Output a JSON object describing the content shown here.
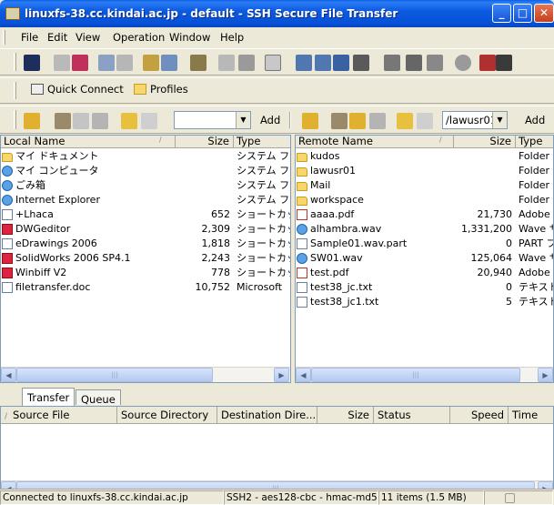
{
  "window": {
    "title": "linuxfs-38.cc.kindai.ac.jp - default - SSH Secure File Transfer"
  },
  "menu": [
    "File",
    "Edit",
    "View",
    "Operation",
    "Window",
    "Help"
  ],
  "toolbar2": {
    "quick_connect": "Quick Connect",
    "profiles": "Profiles"
  },
  "local": {
    "add_label": "Add",
    "path": "",
    "columns": {
      "name": "Local Name",
      "size": "Size",
      "type": "Type"
    },
    "rows": [
      {
        "name": "マイ ドキュメント",
        "size": "",
        "type": "システム フ",
        "icon": "my-documents-icon"
      },
      {
        "name": "マイ コンピュータ",
        "size": "",
        "type": "システム フ",
        "icon": "my-computer-icon"
      },
      {
        "name": "ごみ箱",
        "size": "",
        "type": "システム フ",
        "icon": "recycle-bin-icon"
      },
      {
        "name": "Internet Explorer",
        "size": "",
        "type": "システム フ",
        "icon": "internet-explorer-icon"
      },
      {
        "name": "+Lhaca",
        "size": "652",
        "type": "ショートカッ",
        "icon": "lhaca-icon"
      },
      {
        "name": "DWGeditor",
        "size": "2,309",
        "type": "ショートカッ",
        "icon": "dwgeditor-icon"
      },
      {
        "name": "eDrawings 2006",
        "size": "1,818",
        "type": "ショートカッ",
        "icon": "edrawings-icon"
      },
      {
        "name": "SolidWorks 2006 SP4.1",
        "size": "2,243",
        "type": "ショートカッ",
        "icon": "solidworks-icon"
      },
      {
        "name": "Winbiff V2",
        "size": "778",
        "type": "ショートカッ",
        "icon": "winbiff-icon"
      },
      {
        "name": "filetransfer.doc",
        "size": "10,752",
        "type": "Microsoft",
        "icon": "word-document-icon"
      }
    ]
  },
  "remote": {
    "add_label": "Add",
    "path": "/lawusr01",
    "columns": {
      "name": "Remote Name",
      "size": "Size",
      "type": "Type"
    },
    "rows": [
      {
        "name": "kudos",
        "size": "",
        "type": "Folder",
        "icon": "folder-icon"
      },
      {
        "name": "lawusr01",
        "size": "",
        "type": "Folder",
        "icon": "folder-icon"
      },
      {
        "name": "Mail",
        "size": "",
        "type": "Folder",
        "icon": "folder-icon"
      },
      {
        "name": "workspace",
        "size": "",
        "type": "Folder",
        "icon": "folder-icon"
      },
      {
        "name": "aaaa.pdf",
        "size": "21,730",
        "type": "Adobe A",
        "icon": "pdf-file-icon"
      },
      {
        "name": "alhambra.wav",
        "size": "1,331,200",
        "type": "Wave サ",
        "icon": "wave-file-icon"
      },
      {
        "name": "Sample01.wav.part",
        "size": "0",
        "type": "PART フ",
        "icon": "part-file-icon"
      },
      {
        "name": "SW01.wav",
        "size": "125,064",
        "type": "Wave サ",
        "icon": "wave-file-icon"
      },
      {
        "name": "test.pdf",
        "size": "20,940",
        "type": "Adobe A",
        "icon": "pdf-file-icon"
      },
      {
        "name": "test38_jc.txt",
        "size": "0",
        "type": "テキスト文",
        "icon": "text-file-icon"
      },
      {
        "name": "test38_jc1.txt",
        "size": "5",
        "type": "テキスト文",
        "icon": "text-file-icon"
      }
    ]
  },
  "tabs": [
    "Transfer",
    "Queue"
  ],
  "transfer_columns": [
    "Source File",
    "Source Directory",
    "Destination Dire...",
    "Size",
    "Status",
    "Speed",
    "Time"
  ],
  "status": {
    "connection": "Connected to linuxfs-38.cc.kindai.ac.jp",
    "cipher": "SSH2 - aes128-cbc - hmac-md5 - r",
    "items": "11 items (1.5 MB)"
  }
}
